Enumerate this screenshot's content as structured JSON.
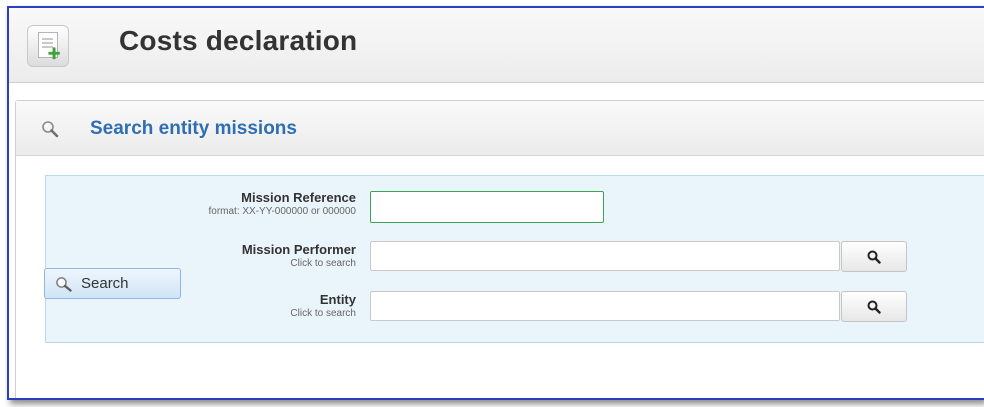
{
  "header": {
    "title": "Costs declaration",
    "icon": "add-document-icon"
  },
  "panel": {
    "title": "Search entity missions",
    "icon": "magnifier-icon"
  },
  "form": {
    "mission_reference": {
      "label": "Mission Reference",
      "hint": "format: XX-YY-000000 or 000000",
      "value": ""
    },
    "mission_performer": {
      "label": "Mission Performer",
      "hint": "Click to search",
      "value": ""
    },
    "entity": {
      "label": "Entity",
      "hint": "Click to search",
      "value": ""
    }
  },
  "search_button": {
    "label": "Search",
    "icon": "magnifier-icon"
  },
  "colors": {
    "accent": "#2f6fb1",
    "form_bg": "#eaf4fb",
    "focus_border": "#3aa655"
  }
}
